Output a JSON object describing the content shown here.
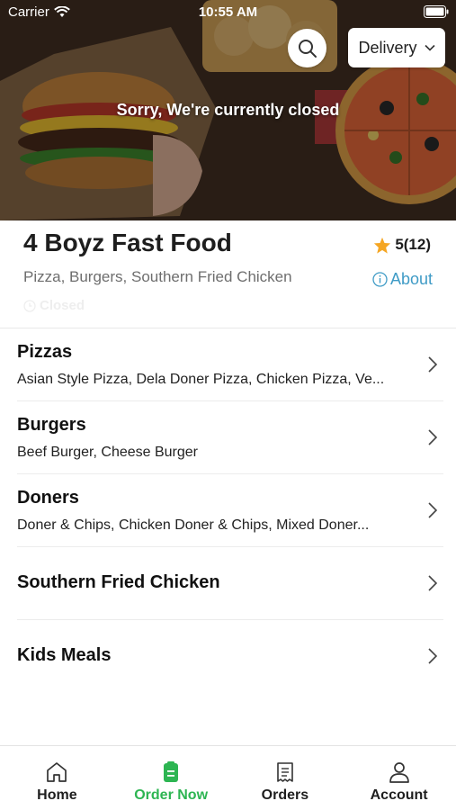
{
  "status_bar": {
    "carrier": "Carrier",
    "time": "10:55 AM"
  },
  "hero": {
    "closed_message": "Sorry, We're currently closed",
    "delivery_select": {
      "value": "Delivery"
    }
  },
  "restaurant": {
    "name": "4 Boyz Fast Food",
    "rating": "5(12)",
    "cuisines": "Pizza, Burgers, Southern Fried Chicken",
    "about_label": "About",
    "status_text": "Closed"
  },
  "categories": [
    {
      "title": "Pizzas",
      "items": "Asian Style Pizza, Dela Doner Pizza, Chicken Pizza, Ve..."
    },
    {
      "title": "Burgers",
      "items": "Beef Burger, Cheese Burger"
    },
    {
      "title": "Doners",
      "items": "Doner & Chips, Chicken Doner & Chips, Mixed Doner..."
    },
    {
      "title": "Southern Fried Chicken",
      "items": ""
    },
    {
      "title": "Kids Meals",
      "items": ""
    }
  ],
  "tab_bar": {
    "tabs": [
      {
        "label": "Home",
        "icon": "home-icon",
        "active": false
      },
      {
        "label": "Order Now",
        "icon": "order-now-icon",
        "active": true
      },
      {
        "label": "Orders",
        "icon": "orders-icon",
        "active": false
      },
      {
        "label": "Account",
        "icon": "account-icon",
        "active": false
      }
    ]
  },
  "colors": {
    "accent_green": "#2db552",
    "link_blue": "#3f9bc6",
    "star_gold": "#f5a623",
    "text_dark": "#1e1e1e",
    "text_muted": "#6e6e6e"
  }
}
